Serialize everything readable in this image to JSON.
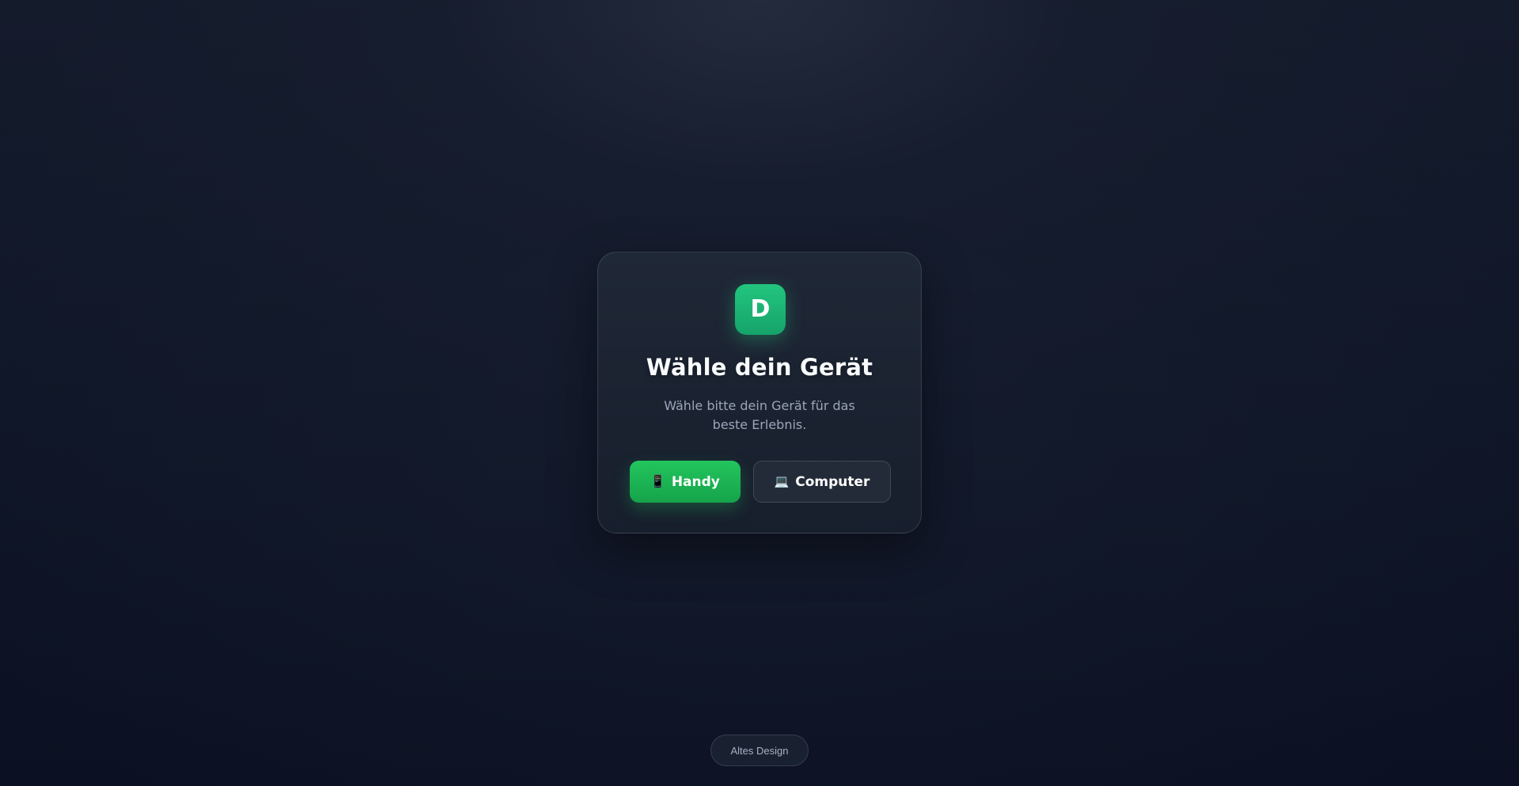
{
  "logo": {
    "letter": "D",
    "color": "#1fbf7a"
  },
  "dialog": {
    "title": "Wähle dein Gerät",
    "subtitle": "Wähle bitte dein Gerät für das beste Erlebnis."
  },
  "buttons": {
    "handy": {
      "icon": "📱",
      "icon_name": "phone-icon",
      "label": "Handy",
      "color": "#22c55e"
    },
    "computer": {
      "icon": "💻",
      "icon_name": "laptop-icon",
      "label": "Computer"
    }
  },
  "footer": {
    "old_design_label": "Altes Design"
  }
}
